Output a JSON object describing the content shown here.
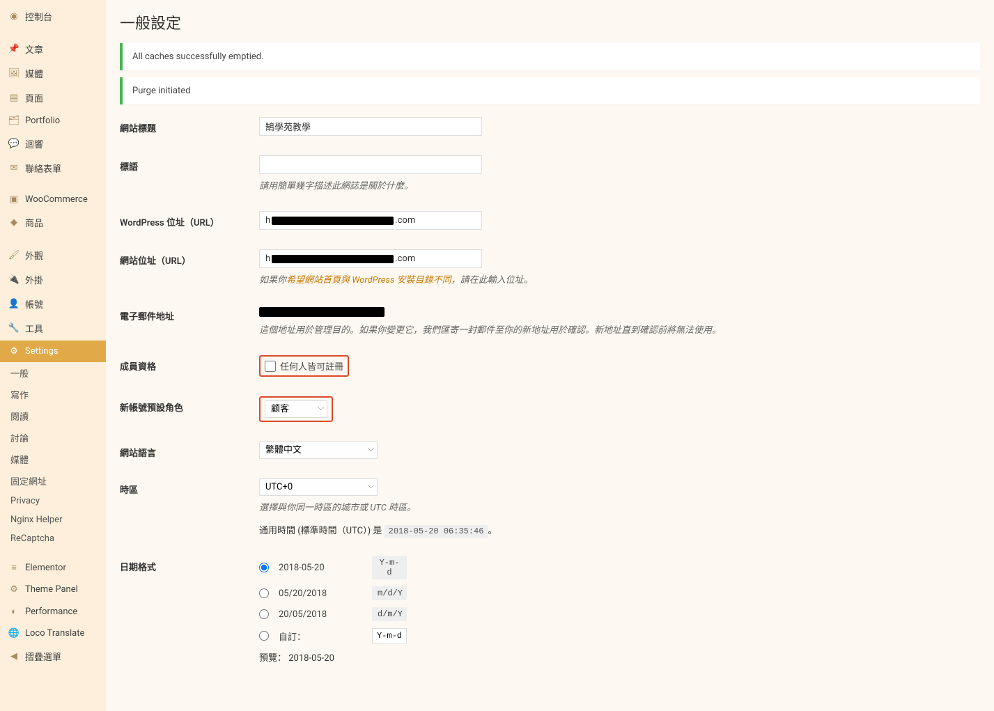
{
  "sidebar": {
    "items": [
      {
        "label": "控制台",
        "icon": "dashboard"
      },
      {
        "label": "文章",
        "icon": "pin"
      },
      {
        "label": "媒體",
        "icon": "media"
      },
      {
        "label": "頁面",
        "icon": "page"
      },
      {
        "label": "Portfolio",
        "icon": "folder"
      },
      {
        "label": "迴響",
        "icon": "comment"
      },
      {
        "label": "聯絡表單",
        "icon": "mail"
      },
      {
        "label": "WooCommerce",
        "icon": "woo"
      },
      {
        "label": "商品",
        "icon": "product"
      },
      {
        "label": "外觀",
        "icon": "brush"
      },
      {
        "label": "外掛",
        "icon": "plugin"
      },
      {
        "label": "帳號",
        "icon": "user"
      },
      {
        "label": "工具",
        "icon": "wrench"
      },
      {
        "label": "Settings",
        "icon": "settings",
        "active": true
      },
      {
        "label": "Elementor",
        "icon": "elementor"
      },
      {
        "label": "Theme Panel",
        "icon": "gear"
      },
      {
        "label": "Performance",
        "icon": "perf"
      },
      {
        "label": "Loco Translate",
        "icon": "loco"
      },
      {
        "label": "摺疊選單",
        "icon": "collapse"
      }
    ],
    "settings_sub": [
      "一般",
      "寫作",
      "閱讀",
      "討論",
      "媒體",
      "固定網址",
      "Privacy",
      "Nginx Helper",
      "ReCaptcha"
    ]
  },
  "page": {
    "title": "一般設定",
    "notice1": "All caches successfully emptied.",
    "notice2": "Purge initiated"
  },
  "form": {
    "site_title_label": "網站標題",
    "site_title_value": "鵠學苑教學",
    "tagline_label": "標語",
    "tagline_value": "",
    "tagline_desc": "請用簡單幾字描述此網誌是關於什麼。",
    "wp_url_label": "WordPress 位址（URL）",
    "wp_url_prefix": "h",
    "wp_url_suffix": ".com",
    "site_url_label": "網站位址（URL）",
    "site_url_prefix": "h",
    "site_url_suffix": ".com",
    "site_url_desc_before": "如果你",
    "site_url_desc_link": "希望網站首頁與 WordPress 安裝目錄不同",
    "site_url_desc_after": "，請在此輸入位址。",
    "email_label": "電子郵件地址",
    "email_desc": "這個地址用於管理目的。如果你變更它，我們匯寄一封郵件至你的新地址用於確認。新地址直到確認前將無法使用。",
    "membership_label": "成員資格",
    "membership_checkbox": "任何人皆可註冊",
    "default_role_label": "新帳號預設角色",
    "default_role_value": "顧客",
    "language_label": "網站語言",
    "language_value": "繁體中文",
    "timezone_label": "時區",
    "timezone_value": "UTC+0",
    "timezone_desc": "選擇與你同一時區的城市或 UTC 時區。",
    "utc_time_before": "通用時間 (標準時間（UTC）) 是 ",
    "utc_time_value": "2018-05-20 06:35:46",
    "utc_time_after": "。",
    "date_format_label": "日期格式",
    "date_options": [
      {
        "display": "2018-05-20",
        "fmt": "Y-m-d",
        "selected": true
      },
      {
        "display": "05/20/2018",
        "fmt": "m/d/Y"
      },
      {
        "display": "20/05/2018",
        "fmt": "d/m/Y"
      }
    ],
    "date_custom_label": "自訂：",
    "date_custom_value": "Y-m-d",
    "date_preview_label": "預覽：",
    "date_preview_value": "2018-05-20"
  }
}
